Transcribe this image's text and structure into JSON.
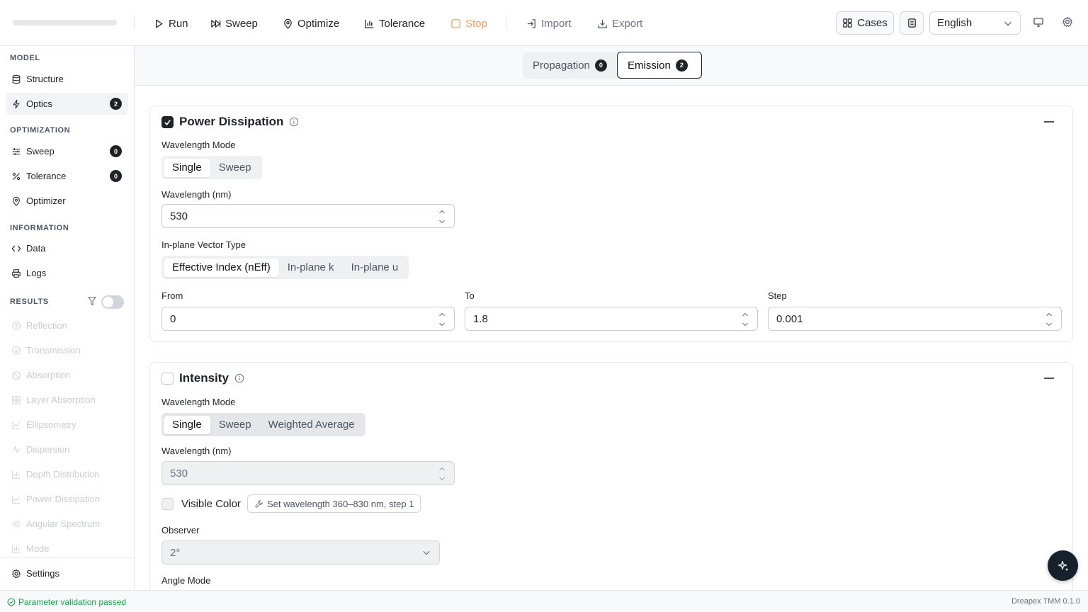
{
  "toolbar": {
    "run": "Run",
    "sweep": "Sweep",
    "optimize": "Optimize",
    "tolerance": "Tolerance",
    "stop": "Stop",
    "import": "Import",
    "export": "Export",
    "cases": "Cases",
    "language": "English"
  },
  "sidebar": {
    "model_title": "MODEL",
    "structure": "Structure",
    "optics": "Optics",
    "optics_badge": "2",
    "optimization_title": "OPTIMIZATION",
    "sweep": "Sweep",
    "sweep_badge": "0",
    "tolerance": "Tolerance",
    "tolerance_badge": "0",
    "optimizer": "Optimizer",
    "information_title": "INFORMATION",
    "data": "Data",
    "logs": "Logs",
    "results_title": "RESULTS",
    "results_filter_enabled": false,
    "results": [
      "Reflection",
      "Transmission",
      "Absorption",
      "Layer Absorption",
      "Ellipsometry",
      "Dispersion",
      "Depth Distribution",
      "Power Dissipation",
      "Angular Spectrum",
      "Mode"
    ],
    "settings": "Settings"
  },
  "tabs": {
    "propagation": "Propagation",
    "propagation_badge": "0",
    "emission": "Emission",
    "emission_badge": "2"
  },
  "power_dissipation": {
    "title": "Power Dissipation",
    "enabled": true,
    "wavelength_mode_label": "Wavelength Mode",
    "mode_single": "Single",
    "mode_sweep": "Sweep",
    "wavelength_label": "Wavelength (nm)",
    "wavelength_value": "530",
    "vector_type_label": "In-plane Vector Type",
    "vector_neff": "Effective Index (nEff)",
    "vector_k": "In-plane k",
    "vector_u": "In-plane u",
    "from_label": "From",
    "from_value": "0",
    "to_label": "To",
    "to_value": "1.8",
    "step_label": "Step",
    "step_value": "0.001"
  },
  "intensity": {
    "title": "Intensity",
    "enabled": false,
    "wavelength_mode_label": "Wavelength Mode",
    "mode_single": "Single",
    "mode_sweep": "Sweep",
    "mode_weighted": "Weighted Average",
    "wavelength_label": "Wavelength (nm)",
    "wavelength_value": "530",
    "visible_color_label": "Visible Color",
    "visible_color_hint": "Set wavelength 360–830 nm, step 1",
    "observer_label": "Observer",
    "observer_value": "2°",
    "angle_mode_label": "Angle Mode"
  },
  "status": {
    "message": "Parameter validation passed",
    "version": "Dreapex TMM 0.1.0"
  },
  "colors": {
    "accent_dark": "#1f2328",
    "stop": "#f0a15a",
    "success": "#16a34a"
  }
}
